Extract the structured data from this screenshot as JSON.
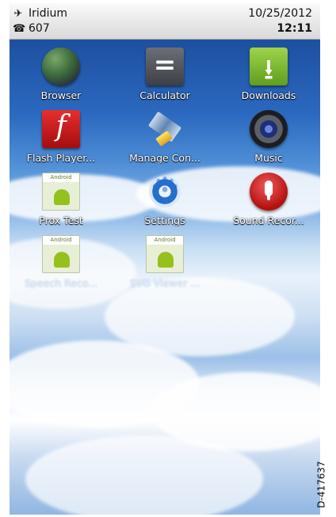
{
  "status_bar": {
    "carrier": "Iridium",
    "line2": "607",
    "date": "10/25/2012",
    "time": "12:11"
  },
  "apps": [
    {
      "label": "Browser",
      "icon": "globe-icon"
    },
    {
      "label": "Calculator",
      "icon": "calculator-icon"
    },
    {
      "label": "Downloads",
      "icon": "download-icon"
    },
    {
      "label": "Flash Player...",
      "icon": "flash-icon"
    },
    {
      "label": "Manage Con...",
      "icon": "satellite-icon"
    },
    {
      "label": "Music",
      "icon": "music-speaker-icon"
    },
    {
      "label": "Prox Test",
      "icon": "android-app-icon"
    },
    {
      "label": "Settings",
      "icon": "gear-icon"
    },
    {
      "label": "Sound Recor...",
      "icon": "microphone-icon"
    },
    {
      "label": "Speech Reco...",
      "icon": "android-app-icon"
    },
    {
      "label": "SVG Viewer ...",
      "icon": "android-app-icon"
    }
  ],
  "figure_id": "D-417637"
}
